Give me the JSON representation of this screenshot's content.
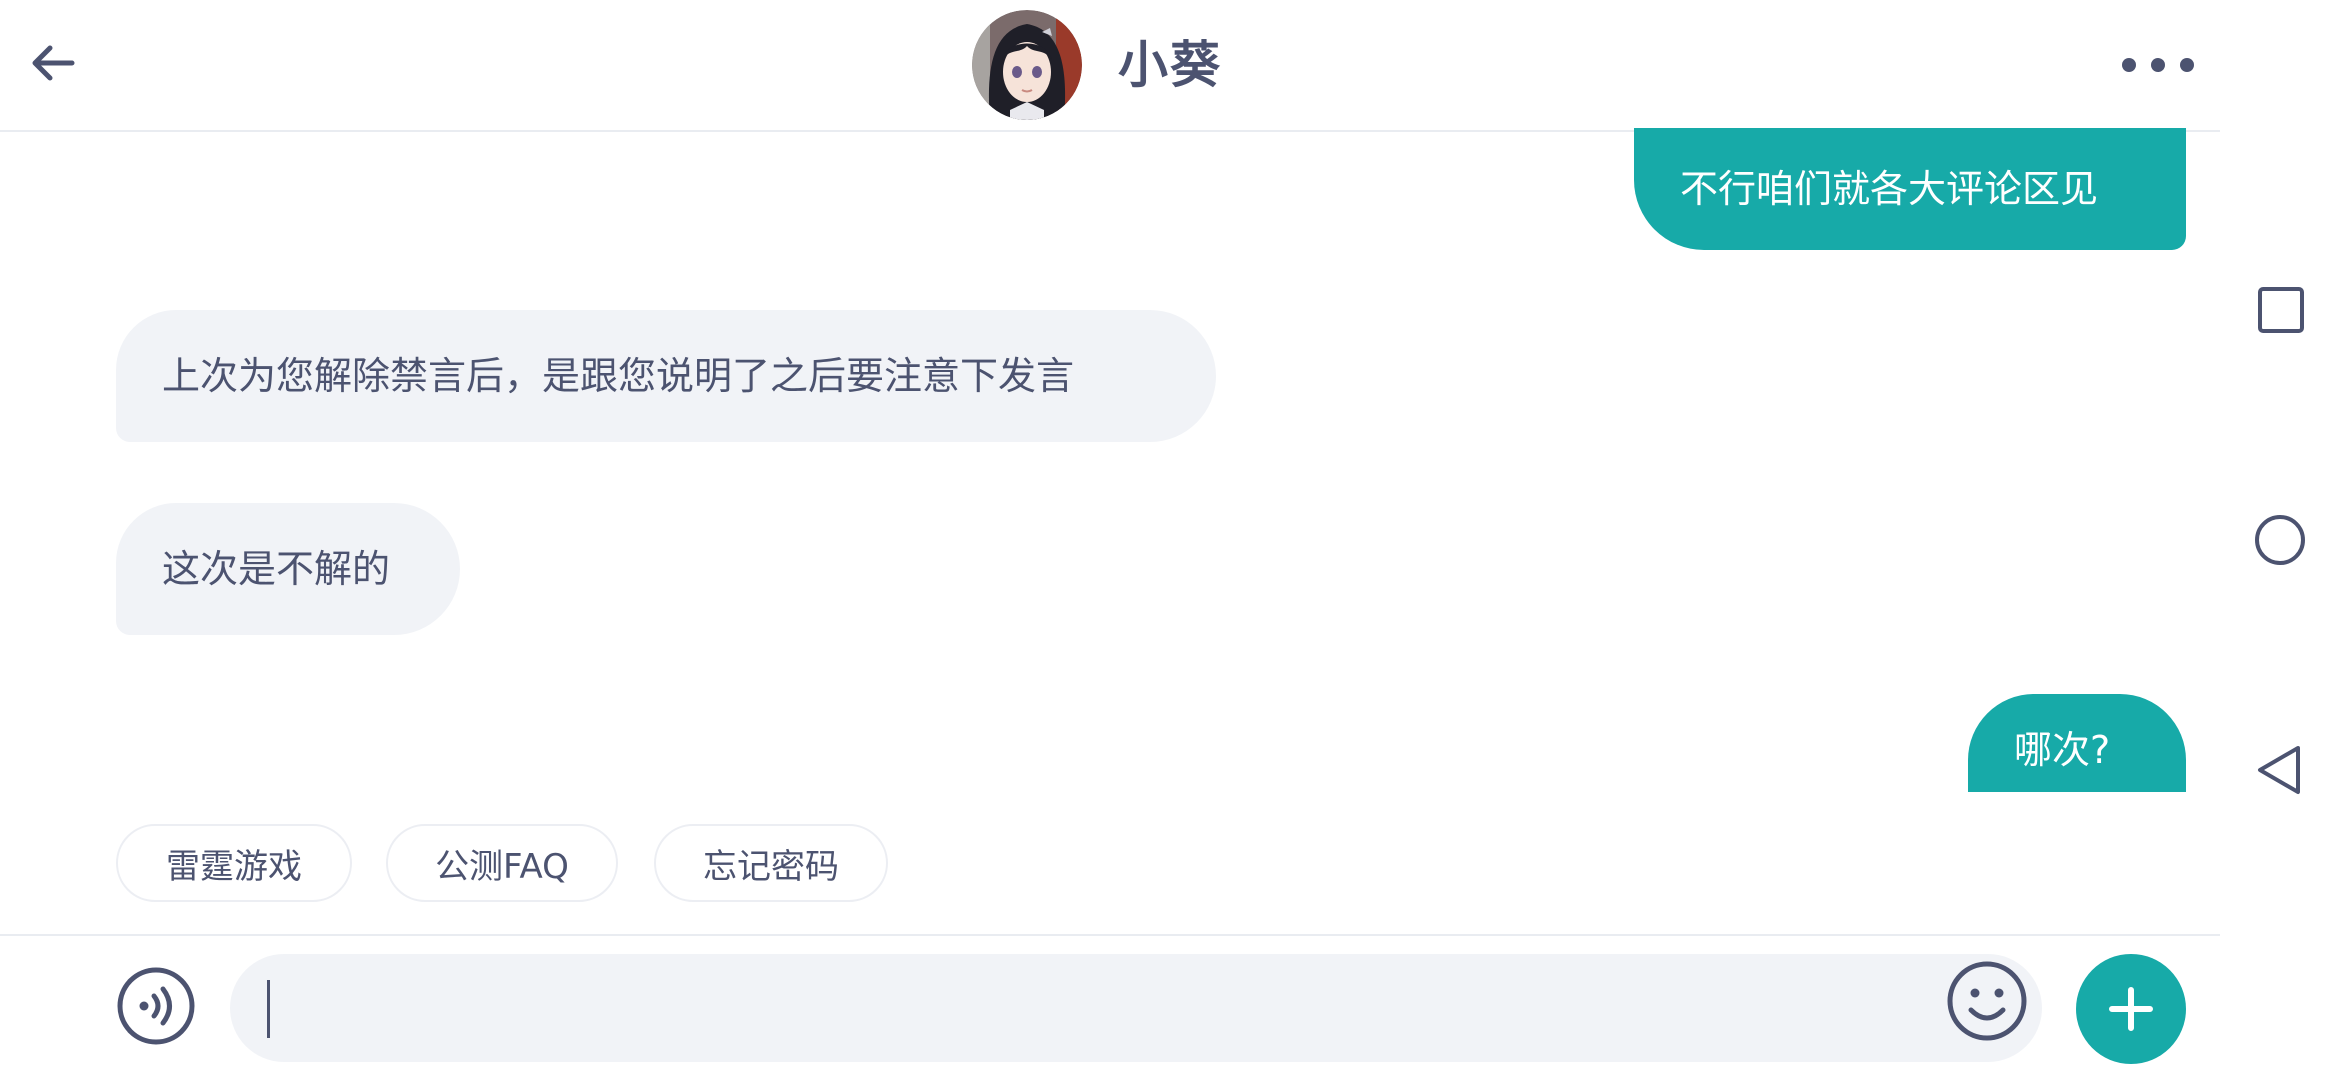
{
  "header": {
    "title": "小葵",
    "back_icon": "arrow-left-icon",
    "more_icon": "more-horizontal-icon"
  },
  "messages": [
    {
      "sender": "user",
      "text": "不行咱们就各大评论区见"
    },
    {
      "sender": "agent",
      "text": "上次为您解除禁言后，是跟您说明了之后要注意下发言"
    },
    {
      "sender": "agent",
      "text": "这次是不解的"
    },
    {
      "sender": "user",
      "text": "哪次?"
    }
  ],
  "quick_replies": [
    "雷霆游戏",
    "公测FAQ",
    "忘记密码"
  ],
  "input": {
    "value": "",
    "placeholder": "",
    "voice_icon": "voice-icon",
    "emoji_icon": "emoji-icon",
    "plus_icon": "plus-icon"
  },
  "system_nav": {
    "recents_icon": "square-recents-icon",
    "home_icon": "circle-home-icon",
    "back_icon": "triangle-back-icon"
  },
  "colors": {
    "accent": "#17aaa8",
    "text": "#4c5370",
    "bubble_gray": "#f1f3f7",
    "divider": "#e9ecf1"
  }
}
